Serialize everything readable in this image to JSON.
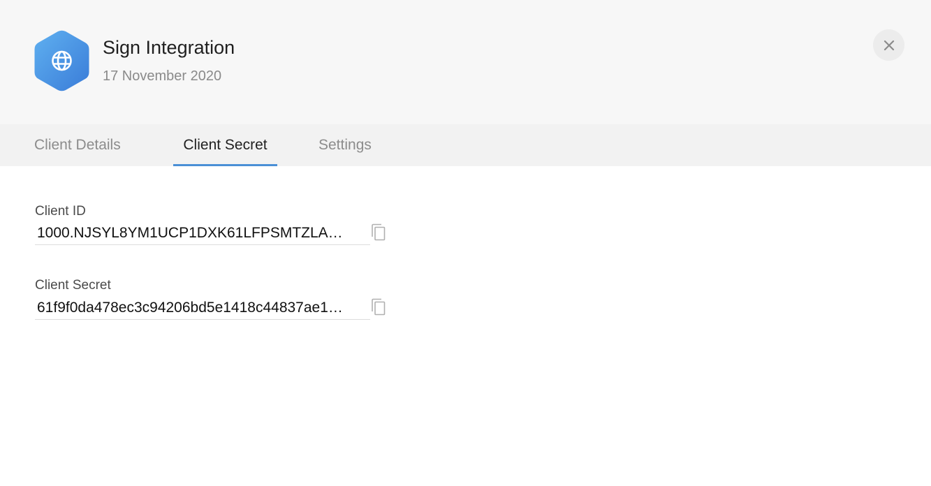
{
  "header": {
    "app_icon": "globe-icon",
    "title": "Sign Integration",
    "date": "17 November 2020",
    "close_icon": "close-icon"
  },
  "tabs": [
    {
      "label": "Client Details",
      "active": false
    },
    {
      "label": "Client Secret",
      "active": true
    },
    {
      "label": "Settings",
      "active": false
    }
  ],
  "fields": {
    "client_id": {
      "label": "Client ID",
      "value": "1000.NJSYL8YM1UCP1DXK61LFPSMTZLA…",
      "copy_icon": "copy-icon"
    },
    "client_secret": {
      "label": "Client Secret",
      "value": "61f9f0da478ec3c94206bd5e1418c44837ae1…",
      "copy_icon": "copy-icon"
    }
  },
  "colors": {
    "accent": "#4a8fd6",
    "icon_gradient_start": "#5aa8ee",
    "icon_gradient_end": "#3a7fd9",
    "header_bg": "#f7f7f7",
    "tabbar_bg": "#f2f2f2"
  }
}
